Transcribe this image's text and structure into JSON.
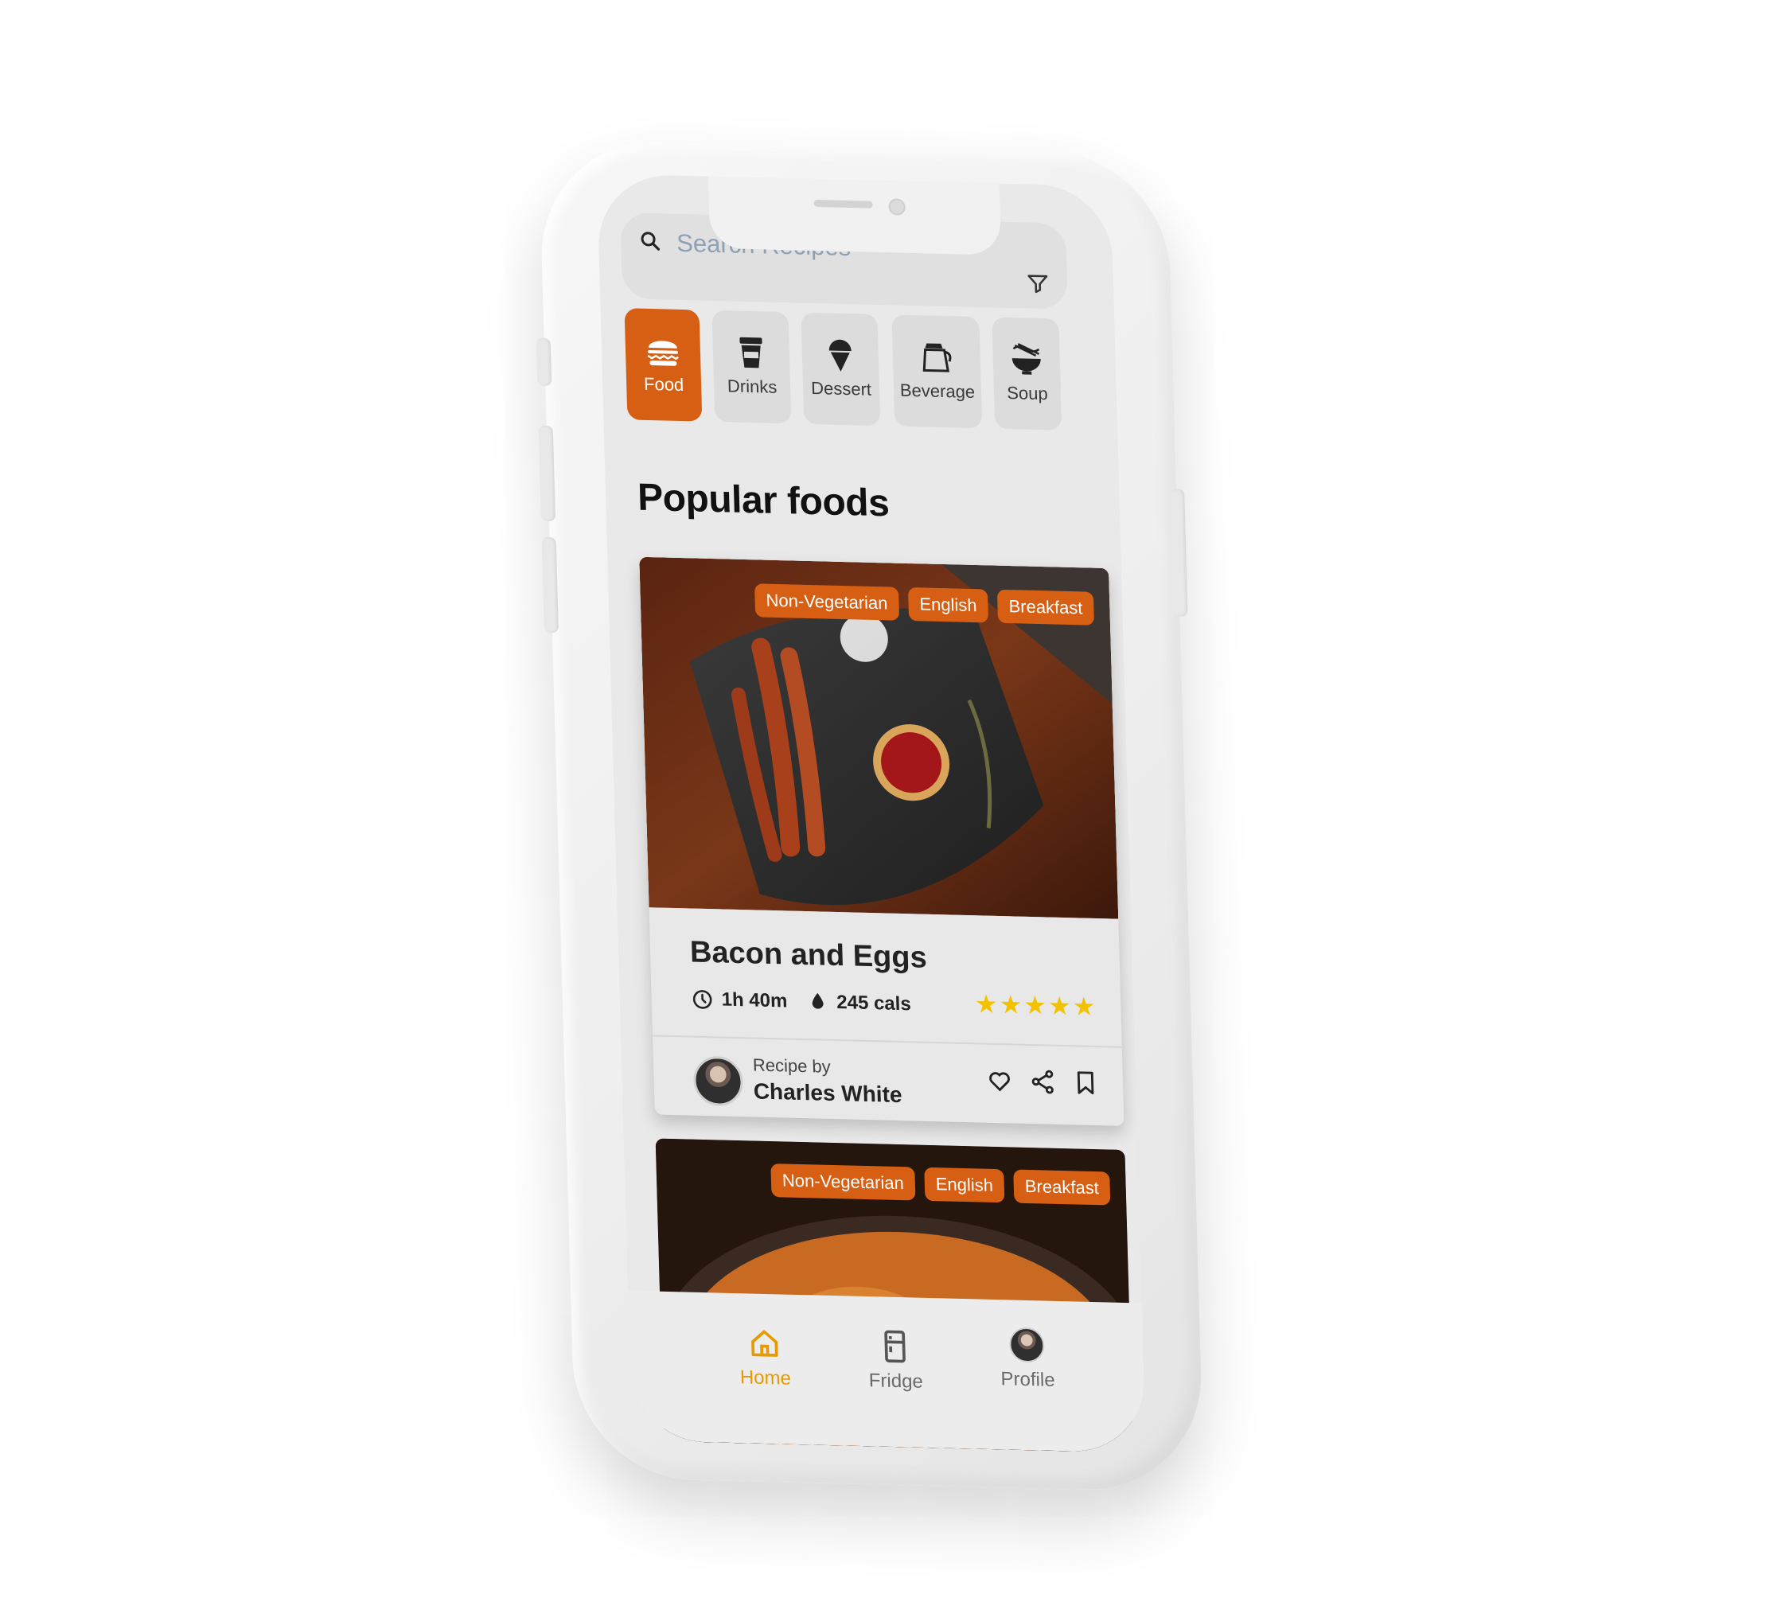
{
  "search": {
    "placeholder": "Search Recipes"
  },
  "categories": [
    {
      "label": "Food",
      "icon": "burger-icon"
    },
    {
      "label": "Drinks",
      "icon": "cup-icon"
    },
    {
      "label": "Dessert",
      "icon": "ice-cream-icon"
    },
    {
      "label": "Beverage",
      "icon": "coffee-pot-icon"
    },
    {
      "label": "Soup",
      "icon": "bowl-icon"
    }
  ],
  "section_title": "Popular foods",
  "recipes": [
    {
      "tags": [
        "Non-Vegetarian",
        "English",
        "Breakfast"
      ],
      "title": "Bacon and Eggs",
      "time": "1h 40m",
      "calories": "245 cals",
      "rating": 5,
      "recipe_by_label": "Recipe by",
      "author": "Charles White"
    },
    {
      "tags": [
        "Non-Vegetarian",
        "English",
        "Breakfast"
      ]
    }
  ],
  "nav": [
    {
      "label": "Home",
      "icon": "home-icon",
      "active": true
    },
    {
      "label": "Fridge",
      "icon": "fridge-icon",
      "active": false
    },
    {
      "label": "Profile",
      "icon": "avatar",
      "active": false
    }
  ],
  "colors": {
    "accent": "#d65f14",
    "nav_active": "#e69a00",
    "star": "#f2c200"
  }
}
